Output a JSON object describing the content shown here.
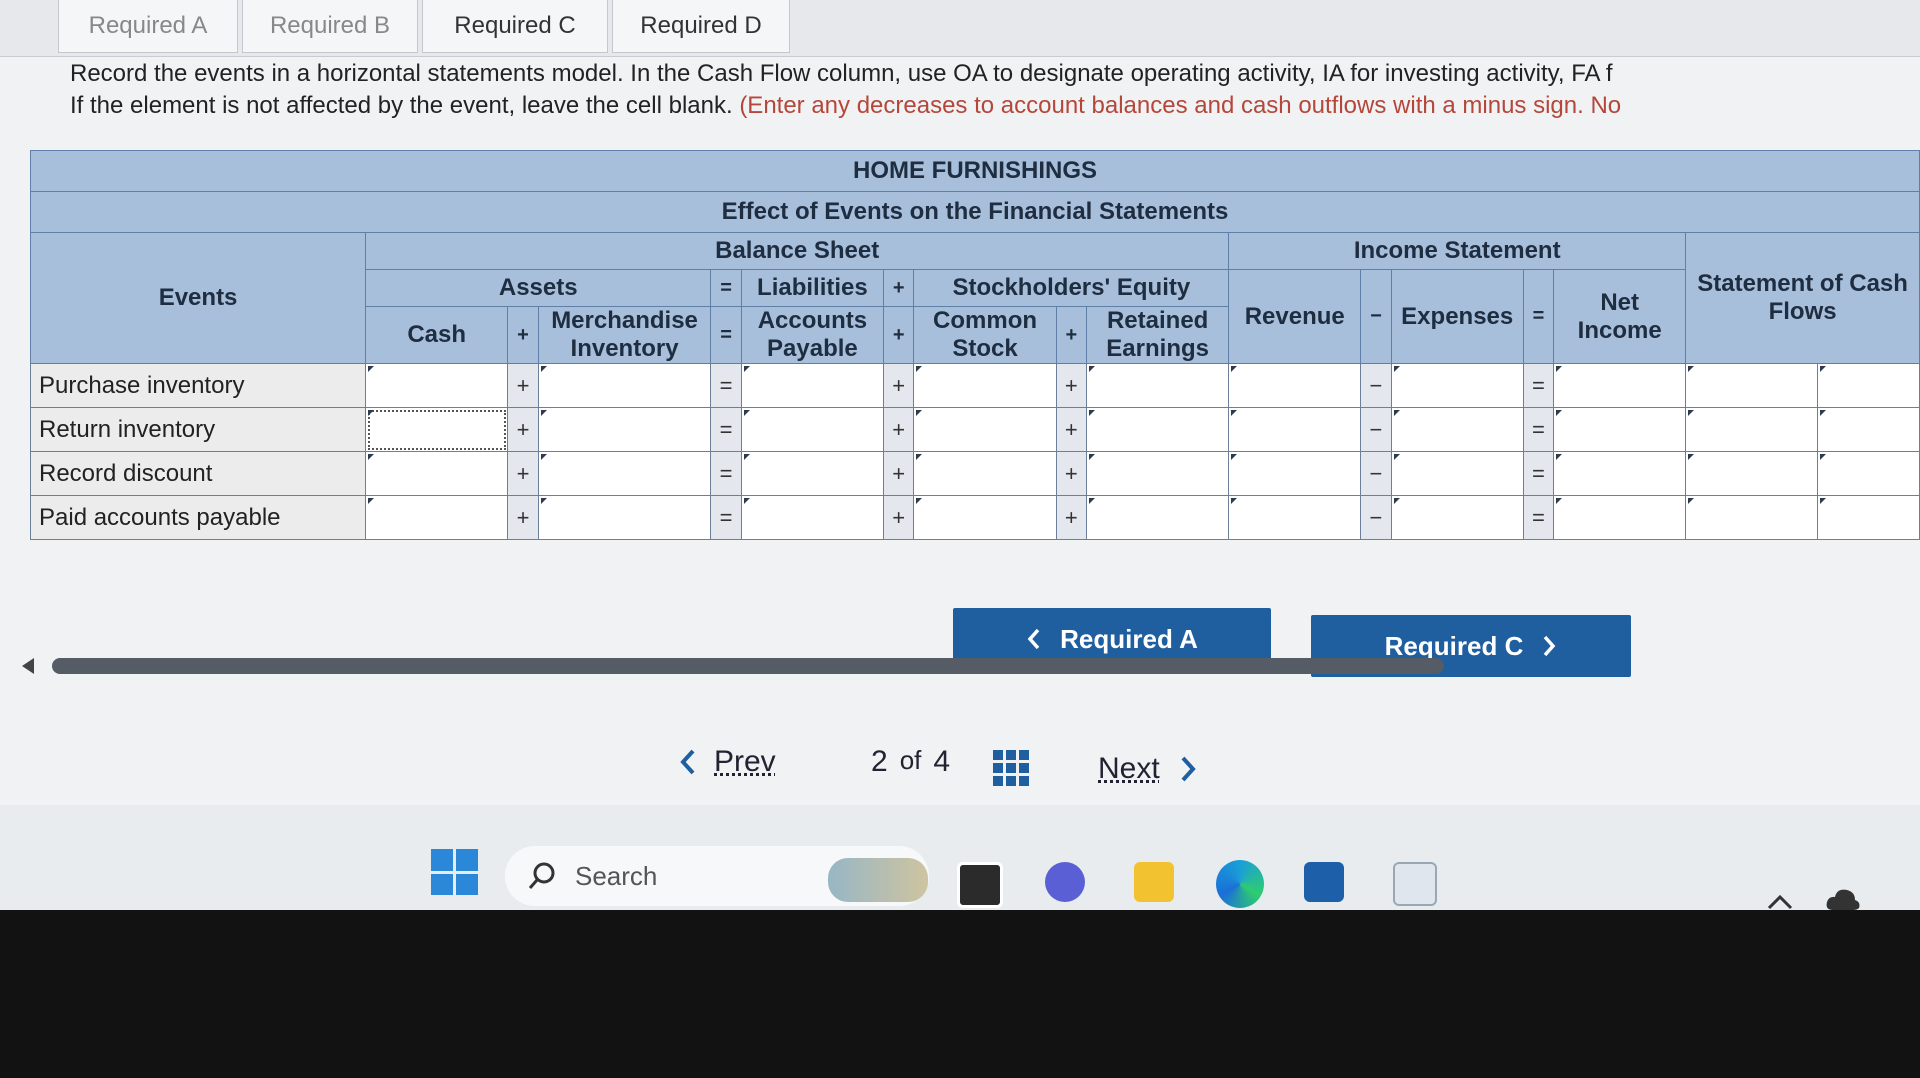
{
  "tabs": [
    "Required A",
    "Required B",
    "Required C",
    "Required D"
  ],
  "instructions": {
    "line1": "Record the events in a horizontal statements model. In the Cash Flow column, use OA to designate operating activity, IA for investing activity, FA f",
    "line2_black": "If the element is not affected by the event, leave the cell blank. ",
    "line2_red": "(Enter any decreases to account balances and cash outflows with a minus sign. No"
  },
  "table": {
    "company": "HOME FURNISHINGS",
    "subtitle": "Effect of Events on the Financial Statements",
    "balance_sheet": "Balance Sheet",
    "income_statement": "Income Statement",
    "cash_flows": "Statement of Cash Flows",
    "events_header": "Events",
    "assets": "Assets",
    "liabilities": "Liabilities",
    "equity": "Stockholders' Equity",
    "cash": "Cash",
    "merch_inventory": "Merchandise Inventory",
    "accounts_payable": "Accounts Payable",
    "common_stock": "Common Stock",
    "retained_earnings": "Retained Earnings",
    "revenue": "Revenue",
    "expenses": "Expenses",
    "net_income": "Net Income",
    "plus": "+",
    "minus": "−",
    "equals": "=",
    "events": [
      "Purchase inventory",
      "Return inventory",
      "Record discount",
      "Paid accounts payable"
    ]
  },
  "buttons": {
    "prev_required": "Required A",
    "next_required": "Required C"
  },
  "pagination": {
    "prev": "Prev",
    "current": "2",
    "of": "of",
    "total": "4",
    "next": "Next"
  },
  "taskbar": {
    "search_placeholder": "Search"
  },
  "colors": {
    "header_blue": "#a8bfdc",
    "button_blue": "#1f5e9f"
  },
  "icons": [
    "chevron-left-icon",
    "chevron-right-icon",
    "grid-icon",
    "windows-start-icon",
    "search-icon",
    "edge-icon",
    "folder-icon",
    "store-icon",
    "chevron-up-icon",
    "cloud-icon"
  ]
}
